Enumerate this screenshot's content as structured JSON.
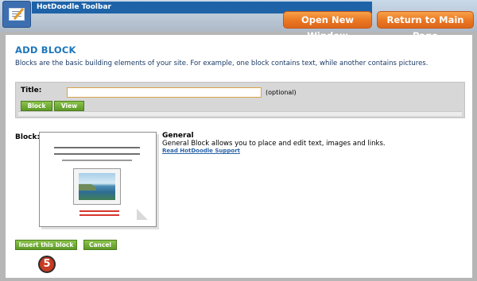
{
  "toolbar": {
    "title": "HotDoodle Toolbar",
    "logo_icon": "hotdoodle-logo-icon",
    "open_new_window": "Open New Window",
    "return_to_main": "Return to Main Page"
  },
  "page": {
    "heading": "ADD BLOCK",
    "intro": "Blocks are the basic building elements of your site. For example, one block contains text, while another contains pictures."
  },
  "form": {
    "title_label": "Title:",
    "title_value": "",
    "title_placeholder": "",
    "optional_hint": "(optional)",
    "tabs": {
      "block": "Block",
      "view": "View"
    }
  },
  "block": {
    "label": "Block:",
    "name": "General",
    "description": "General Block allows you to place and edit text, images and links.",
    "support_link": "Read HotDoodle Support"
  },
  "actions": {
    "insert": "Insert this block",
    "cancel": "Cancel"
  },
  "step_marker": "5",
  "colors": {
    "heading": "#1d76bb",
    "orange_button": "#ea7722",
    "green_button": "#5d9a26",
    "toolbar_strip": "#1e63a8",
    "step_badge": "#c83b22"
  }
}
